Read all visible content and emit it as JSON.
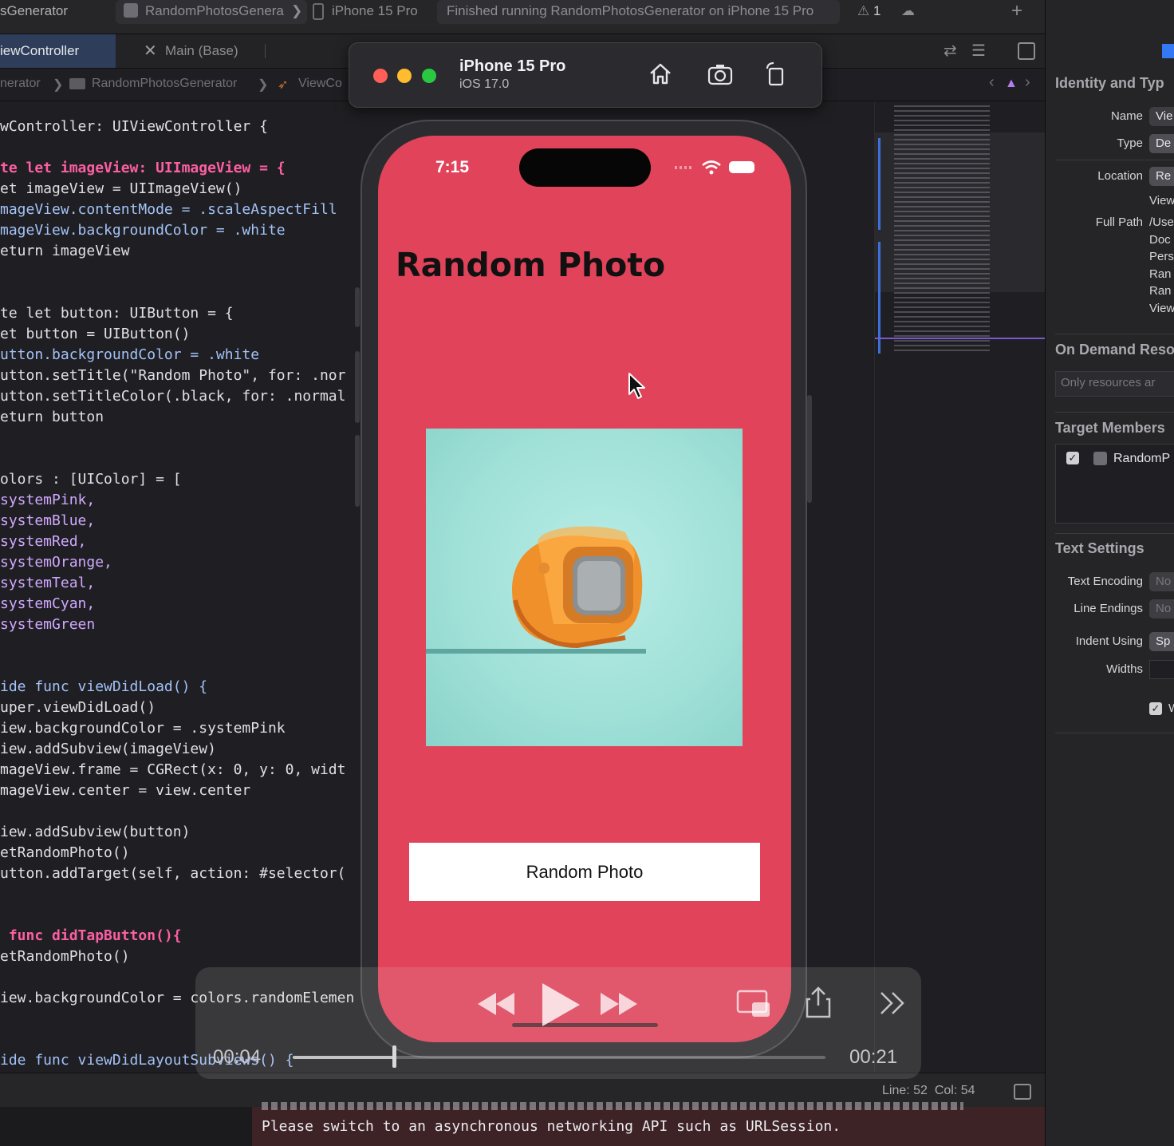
{
  "toolbar": {
    "project_fragment": "sGenerator",
    "scheme": "RandomPhotosGenera",
    "destination": "iPhone 15 Pro",
    "status": "Finished running RandomPhotosGenerator on iPhone 15 Pro",
    "warning_count": "1",
    "add_label": "+"
  },
  "tabs": {
    "active": "iewController",
    "main": "Main (Base)"
  },
  "breadcrumb": {
    "c1": "nerator",
    "c2": "RandomPhotosGenerator",
    "c3": "ViewCo"
  },
  "code": [
    "wController: UIViewController {",
    "",
    "te let imageView: UIImageView = {",
    "et imageView = UIImageView()",
    "mageView.contentMode = .scaleAspectFill",
    "mageView.backgroundColor = .white",
    "eturn imageView",
    "",
    "",
    "te let button: UIButton = {",
    "et button = UIButton()",
    "utton.backgroundColor = .white",
    "utton.setTitle(\"Random Photo\", for: .nor",
    "utton.setTitleColor(.black, for: .normal",
    "eturn button",
    "",
    "",
    "olors : [UIColor] = [",
    "systemPink,",
    "systemBlue,",
    "systemRed,",
    "systemOrange,",
    "systemTeal,",
    "systemCyan,",
    "systemGreen",
    "",
    "",
    "ide func viewDidLoad() {",
    "uper.viewDidLoad()",
    "iew.backgroundColor = .systemPink",
    "iew.addSubview(imageView)",
    "mageView.frame = CGRect(x: 0, y: 0, widt",
    "mageView.center = view.center",
    "",
    "iew.addSubview(button)",
    "etRandomPhoto()",
    "utton.addTarget(self, action: #selector(",
    "",
    " func didTapButton(){",
    "etRandomPhoto()",
    "",
    "iew.backgroundColor = colors.randomElemen",
    "",
    "ide func viewDidLayoutSubviews() {"
  ],
  "simulator": {
    "device": "iPhone 15 Pro",
    "os": "iOS 17.0"
  },
  "phone": {
    "time": "7:15",
    "title": "Random Photo",
    "button_label": "Random Photo",
    "background": "#e0435a"
  },
  "video": {
    "current": "00:04",
    "total": "00:21",
    "progress": 0.19
  },
  "status": {
    "position": "Line: 52  Col: 54"
  },
  "console": {
    "message": "Please switch to an asynchronous networking API such as URLSession."
  },
  "inspector": {
    "identity_header": "Identity and Typ",
    "name_label": "Name",
    "name_value": "Vie",
    "type_label": "Type",
    "type_value": "De",
    "location_label": "Location",
    "location_value": "Re",
    "location_sub": "View",
    "full_path_label": "Full Path",
    "full_path_lines": [
      "/Use",
      "Doc",
      "Pers",
      "Ran",
      "Ran",
      "View"
    ],
    "odr_header": "On Demand Reso",
    "odr_placeholder": "Only resources ar",
    "target_header": "Target Members",
    "target_item": "RandomP",
    "text_header": "Text Settings",
    "encoding_label": "Text Encoding",
    "encoding_value": "No",
    "endings_label": "Line Endings",
    "endings_value": "No",
    "indent_label": "Indent Using",
    "indent_value": "Sp",
    "widths_label": "Widths",
    "wrap_label": "W"
  }
}
